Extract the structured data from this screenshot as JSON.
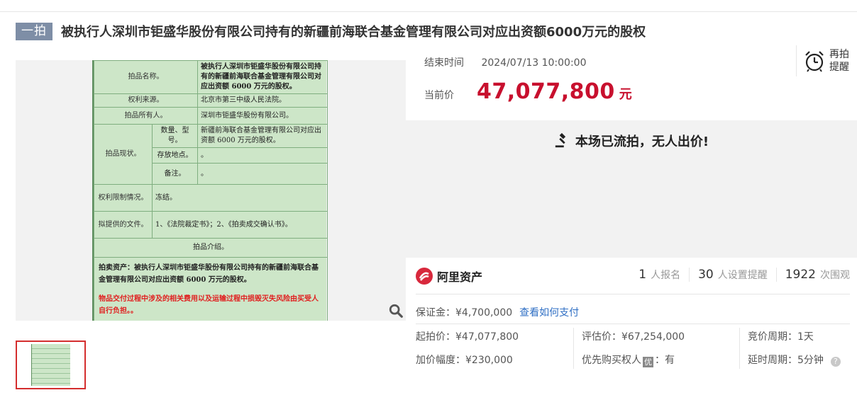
{
  "header": {
    "tag": "一拍",
    "title": "被执行人深圳市钜盛华股份有限公司持有的新疆前海联合基金管理有限公司对应出资额6000万元的股权"
  },
  "document": {
    "rows": [
      {
        "label": "拍品名称。",
        "value": "被执行人深圳市钜盛华股份有限公司持有的新疆前海联合基金管理有限公司对应出资额 6000 万元的股权。"
      },
      {
        "label": "权利来源。",
        "value": "北京市第三中级人民法院。"
      },
      {
        "label": "拍品所有人。",
        "value": "深圳市钜盛华股份有限公司。"
      }
    ],
    "status_label": "拍品现状。",
    "status_rows": [
      {
        "label": "数量、型号。",
        "value": "新疆前海联合基金管理有限公司对应出资额 6000 万元的股权。"
      },
      {
        "label": "存放地点。",
        "value": "。"
      },
      {
        "label": "备注。",
        "value": "。"
      }
    ],
    "restriction": {
      "label": "权利限制情况。",
      "value": "冻结。"
    },
    "docs": {
      "label": "拟提供的文件。",
      "value": "1、《法院裁定书》；2、《拍卖成交确认书》。"
    },
    "intro_heading": "拍品介绍。",
    "intro_text": "拍卖资产：被执行人深圳市钜盛华股份有限公司持有的新疆前海联合基金管理有限公司对应出资额 6000 万元的股权。",
    "warning": "物品交付过程中涉及的相关费用以及运输过程中损毁灭失风险由买受人自行负担。。",
    "tail": "。"
  },
  "auction": {
    "end_label": "结束时间",
    "end_time": "2024/07/13 10:00:00",
    "remind_label": "再拍提醒",
    "price_label": "当前价",
    "price": "47,077,800",
    "price_unit": "元",
    "status": "本场已流拍，无人出价!"
  },
  "brand": {
    "name": "阿里资产"
  },
  "stats": [
    {
      "count": "1",
      "label": "人报名"
    },
    {
      "count": "30",
      "label": "人设置提醒"
    },
    {
      "count": "1922",
      "label": "次围观"
    }
  ],
  "details": {
    "deposit": "保证金：¥4,700,000",
    "pay_link": "查看如何支付",
    "start_price": "起拍价：¥47,077,800",
    "increment": "加价幅度：¥230,000",
    "appraisal": "评估价：¥67,254,000",
    "priority_label": "优先购买权人",
    "priority_badge": "优",
    "priority_value": "：有",
    "bid_period": "竞价周期：1天",
    "delay_period": "延时周期：5分钟"
  },
  "colors": {
    "price": "#c8102e",
    "link": "#2f6fc4",
    "tag": "#7e8ea6",
    "doc_bg": "#cde6c8",
    "thumb_border": "#d42e2e"
  },
  "icons": [
    "alarm-clock-icon",
    "gavel-icon",
    "ali-brand-icon",
    "magnifier-icon",
    "help-icon"
  ]
}
